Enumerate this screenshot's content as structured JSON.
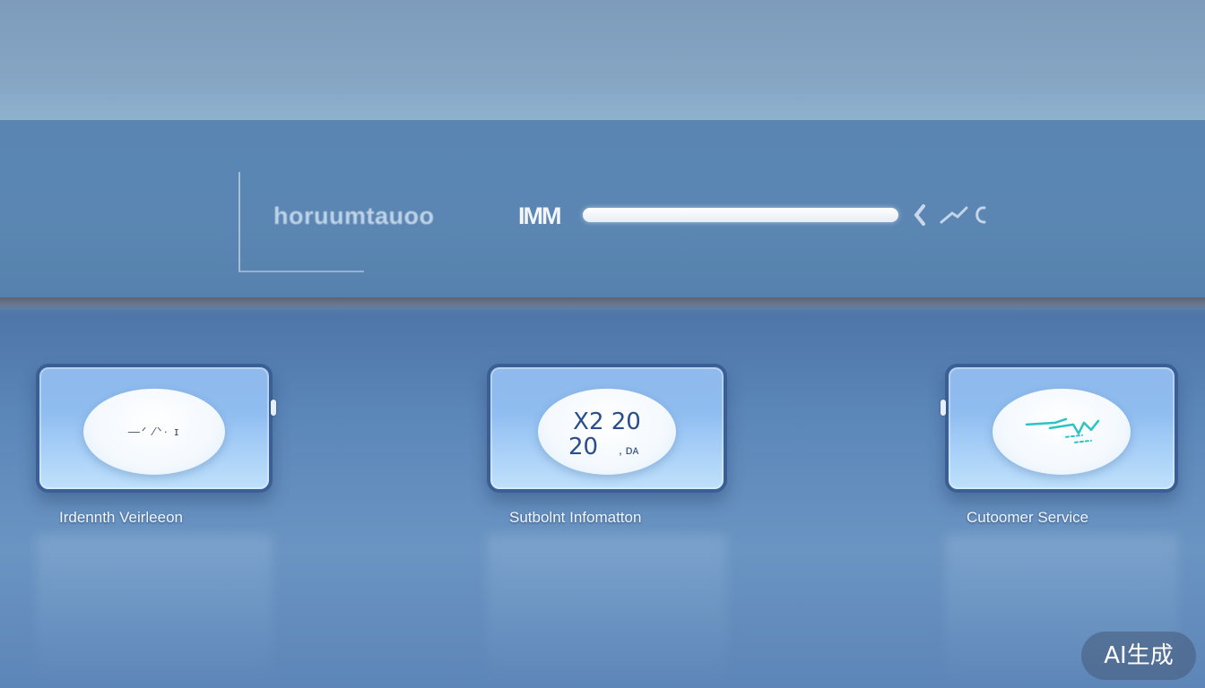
{
  "header": {
    "search_label": "horuumtauoo",
    "search_prefix": "IMM",
    "progress": 1.0
  },
  "cards": [
    {
      "label": "Irdennth Veirleeon",
      "bubble_text": "—ᐟ ⁄ᐠ·  ɪ"
    },
    {
      "label": "Sutbolnt Infomatton",
      "bubble_line1": "X2 20",
      "bubble_line2": "20",
      "bubble_line3": ", ᴅᴀ"
    },
    {
      "label": "Cutoomer Service"
    }
  ],
  "badge": {
    "text": "AI生成"
  },
  "colors": {
    "header_bg": "#5a85b3",
    "card_border": "#3a5f94",
    "card_fill": "#9ec8f5",
    "bubble_text": "#2a4e8c",
    "accent_teal": "#2cc3c7"
  },
  "icons": {
    "search": "search-icon",
    "card_1": "chat-bubble-icon",
    "card_2": "chat-bubble-icon",
    "card_3": "chat-bubble-icon"
  }
}
